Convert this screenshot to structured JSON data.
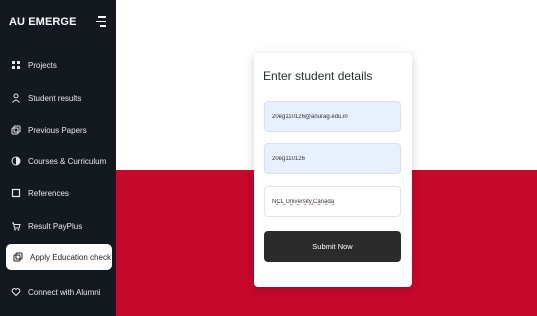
{
  "sidebar": {
    "brand": "AU EMERGE",
    "items": [
      {
        "label": "Projects",
        "icon": "grid-icon"
      },
      {
        "label": "Student results",
        "icon": "user-icon"
      },
      {
        "label": "Previous Papers",
        "icon": "copy-icon"
      },
      {
        "label": "Courses & Curriculum",
        "icon": "circle-half-icon"
      },
      {
        "label": "References",
        "icon": "square-icon"
      },
      {
        "label": "Result PayPlus",
        "icon": "cart-icon"
      },
      {
        "label": "Apply Education check",
        "icon": "copy-icon",
        "active": true
      },
      {
        "label": "Connect with Alumni",
        "icon": "heart-icon"
      }
    ]
  },
  "form": {
    "title": "Enter student details",
    "email_value": "20eg110126@anurag.edu.in",
    "roll_value": "20eg110126",
    "university_value": "NCL University,Canada",
    "submit_label": "Submit Now"
  },
  "colors": {
    "sidebar_bg": "#14191f",
    "hero_red": "#c6082b",
    "input_fill": "#e8effd",
    "button_dark": "#2b2b2b"
  }
}
